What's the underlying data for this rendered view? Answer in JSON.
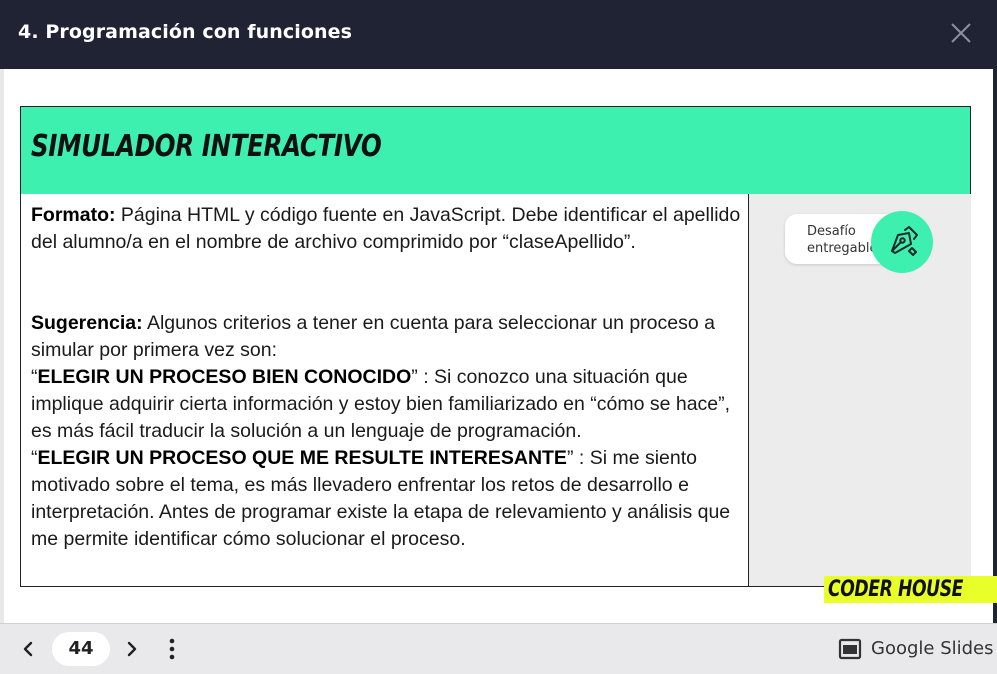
{
  "window": {
    "title": "4. Programación con funciones",
    "close_icon": "close-icon"
  },
  "slide": {
    "header": "SIMULADOR INTERACTIVO",
    "formato_label": "Formato:",
    "formato_text": " Página HTML y código fuente en JavaScript. Debe identificar el apellido del alumno/a en el nombre de archivo comprimido por “claseApellido”.",
    "sugerencia_label": "Sugerencia:",
    "sugerencia_text": " Algunos criterios a tener en cuenta para seleccionar un proceso a simular por primera vez son:",
    "q_open_1": "“",
    "crit1_label": "ELEGIR UN PROCESO BIEN CONOCIDO",
    "crit1_text": "” :  Si conozco una situación que implique adquirir cierta información y estoy bien familiarizado en “cómo se hace”, es más fácil traducir la solución a un lenguaje de programación.",
    "q_open_2": "“",
    "crit2_label": "ELEGIR UN PROCESO QUE ME RESULTE INTERESANTE",
    "crit2_text": "” : Si me siento motivado sobre el tema, es más llevadero enfrentar los retos de desarrollo e interpretación. Antes de programar existe la etapa de relevamiento y análisis que me permite identificar cómo solucionar el proceso.",
    "badge_line1": "Desafío",
    "badge_line2": "entregable",
    "logo": "CODER HOUSE",
    "accent_color": "#3ef0b0",
    "logo_color": "#e8ff2a"
  },
  "bottombar": {
    "page_number": "44",
    "app_label": "Google Slides"
  }
}
